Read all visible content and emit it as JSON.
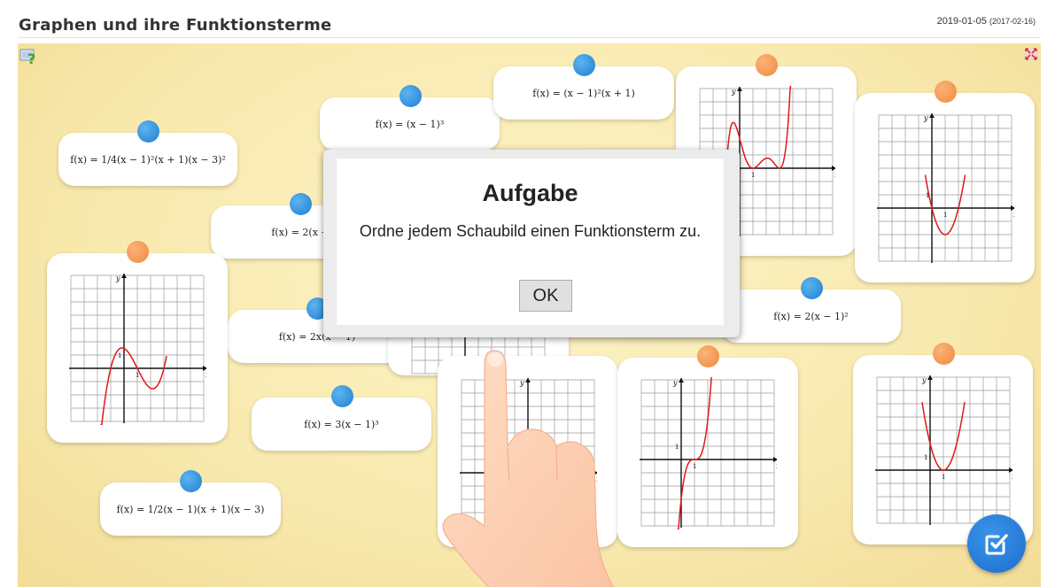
{
  "header": {
    "title": "Graphen und ihre Funktionsterme",
    "date": "2019-01-05",
    "date_original": "(2017-02-16)"
  },
  "icons": {
    "help": "help-icon",
    "fullscreen": "fullscreen-icon",
    "check": "check-icon",
    "hand": "pointing-hand-icon"
  },
  "terms": [
    "f(x) = 1/4(x − 1)²(x + 1)(x − 3)²",
    "f(x) = (x − 1)³",
    "f(x) = (x − 1)²(x + 1)",
    "f(x) = 2(x + ",
    "f(x) = 2x(x − 1)",
    "f(x) = 3(x − 1)³",
    "f(x) = 1/2(x − 1)(x + 1)(x − 3)",
    "f(x) = 2(x − 1)²"
  ],
  "graph_labels": {
    "x": "x",
    "y": "y",
    "one": "1"
  },
  "dialog": {
    "title": "Aufgabe",
    "text": "Ordne jedem Schaubild einen Funktionsterm zu.",
    "ok": "OK"
  },
  "colors": {
    "pin_blue": "#2a8ae0",
    "pin_orange": "#f39a52",
    "curve": "#e01818",
    "check_button": "#2a7fe0"
  }
}
